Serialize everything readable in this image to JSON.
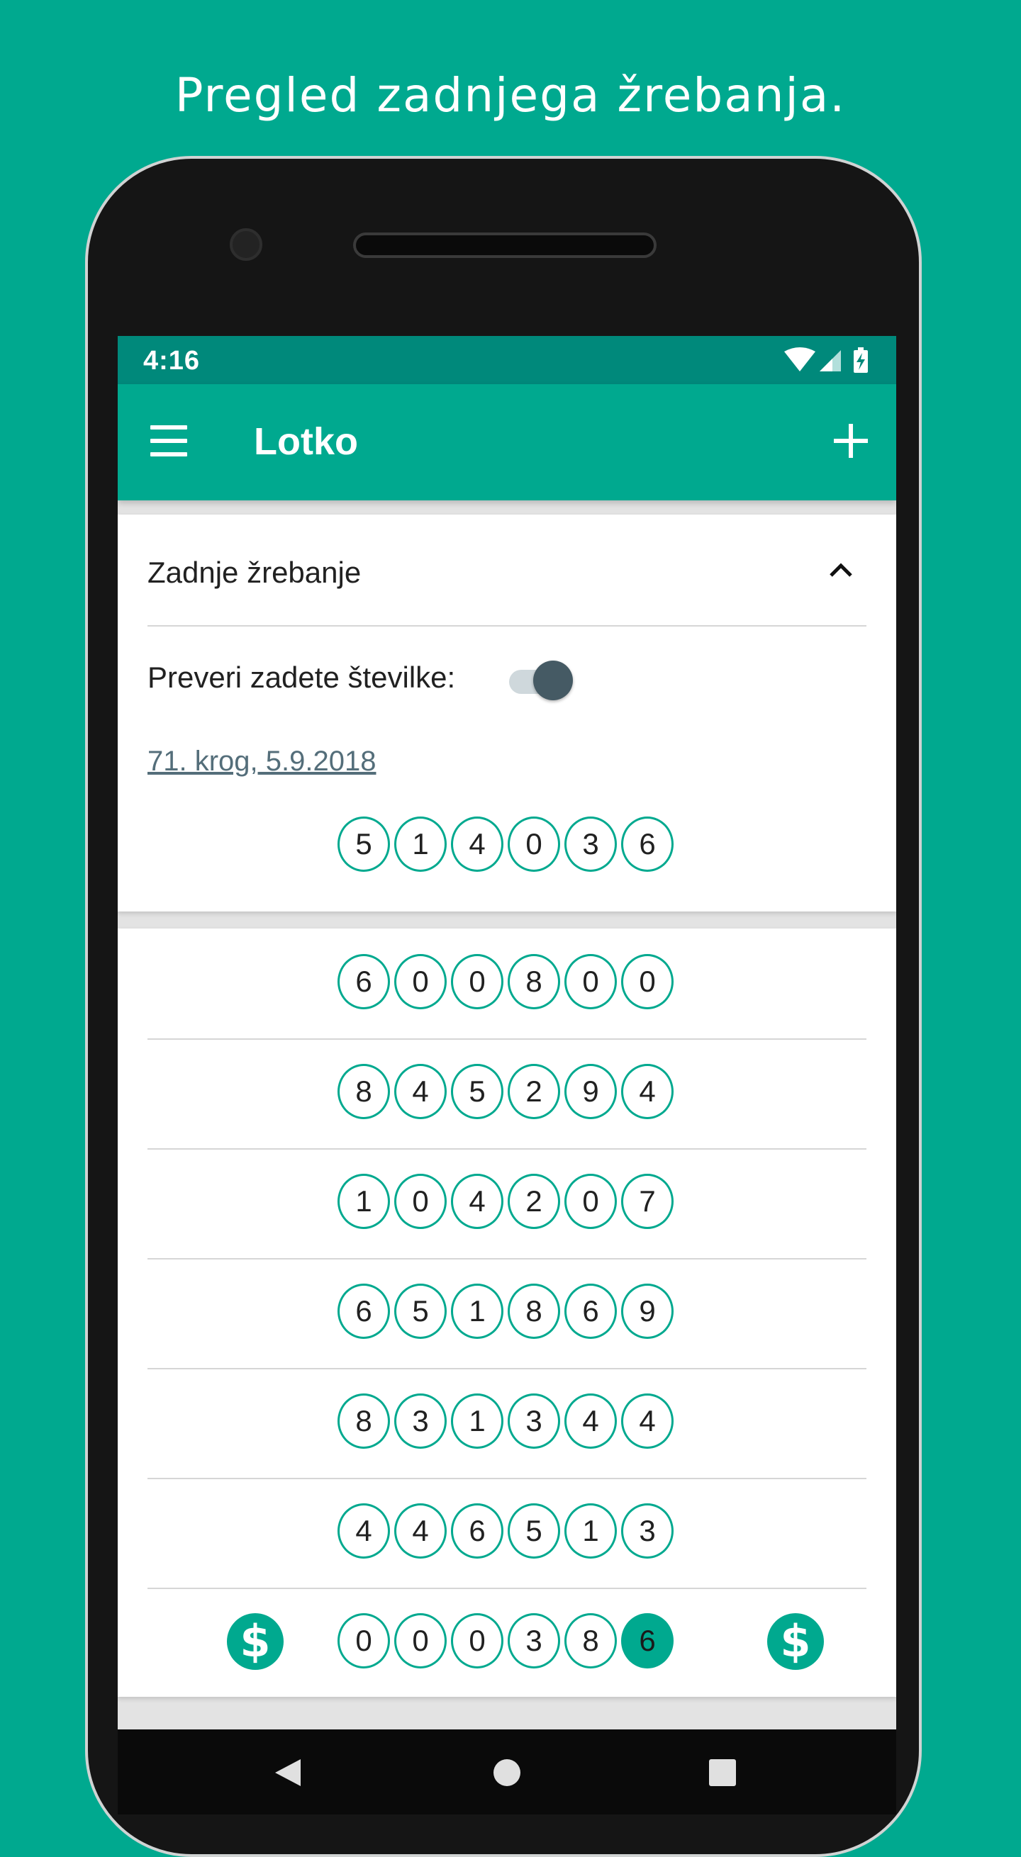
{
  "caption": "Pregled zadnjega žrebanja.",
  "status_bar": {
    "time": "4:16"
  },
  "app_bar": {
    "title": "Lotko"
  },
  "colors": {
    "accent": "#00a98f",
    "status_bar": "#00897b",
    "switch_thumb": "#455a64",
    "link": "#546e7a"
  },
  "last_draw": {
    "title": "Zadnje žrebanje",
    "check_label": "Preveri zadete številke:",
    "check_enabled": true,
    "round_link": "71. krog, 5.9.2018",
    "numbers": [
      "5",
      "1",
      "4",
      "0",
      "3",
      "6"
    ]
  },
  "tickets": [
    {
      "numbers": [
        "6",
        "0",
        "0",
        "8",
        "0",
        "0"
      ],
      "hits": []
    },
    {
      "numbers": [
        "8",
        "4",
        "5",
        "2",
        "9",
        "4"
      ],
      "hits": []
    },
    {
      "numbers": [
        "1",
        "0",
        "4",
        "2",
        "0",
        "7"
      ],
      "hits": []
    },
    {
      "numbers": [
        "6",
        "5",
        "1",
        "8",
        "6",
        "9"
      ],
      "hits": []
    },
    {
      "numbers": [
        "8",
        "3",
        "1",
        "3",
        "4",
        "4"
      ],
      "hits": []
    },
    {
      "numbers": [
        "4",
        "4",
        "6",
        "5",
        "1",
        "3"
      ],
      "hits": []
    },
    {
      "numbers": [
        "0",
        "0",
        "0",
        "3",
        "8",
        "6"
      ],
      "hits": [
        5
      ],
      "winning": true
    }
  ],
  "icons": {
    "winner": "$"
  }
}
